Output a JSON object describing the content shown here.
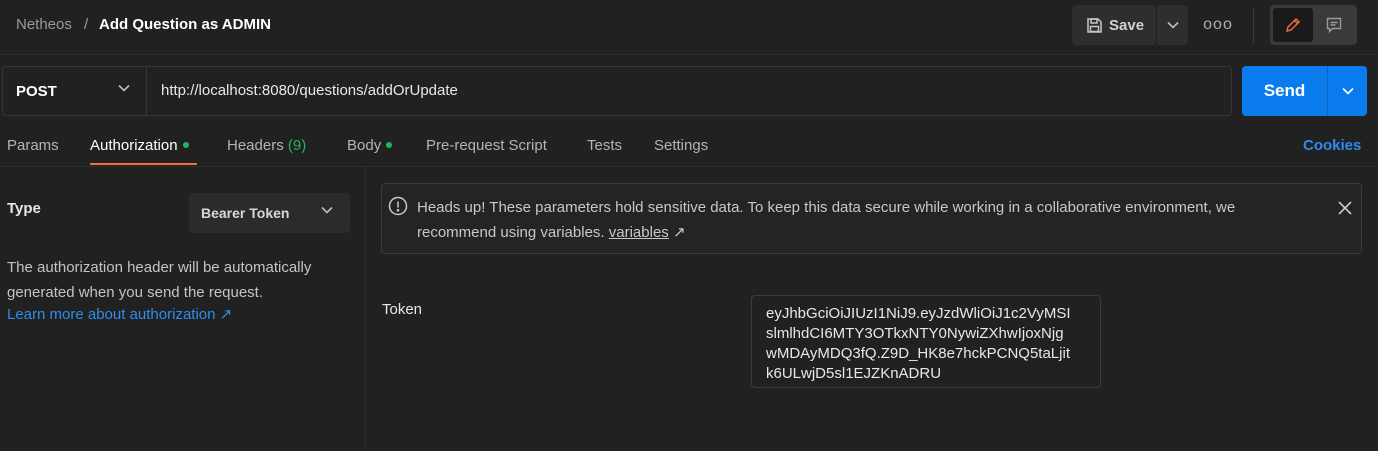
{
  "header": {
    "workspace": "Netheos",
    "separator": "/",
    "request_name": "Add Question as ADMIN",
    "save_label": "Save",
    "more_label": "ooo"
  },
  "request": {
    "method": "POST",
    "url": "http://localhost:8080/questions/addOrUpdate",
    "send_label": "Send"
  },
  "tabs": [
    {
      "label": "Params"
    },
    {
      "label": "Authorization",
      "dot": true,
      "active": true
    },
    {
      "label": "Headers",
      "count": "(9)"
    },
    {
      "label": "Body",
      "dot": true
    },
    {
      "label": "Pre-request Script"
    },
    {
      "label": "Tests"
    },
    {
      "label": "Settings"
    }
  ],
  "cookies_label": "Cookies",
  "auth": {
    "type_label": "Type",
    "type_value": "Bearer Token",
    "description": "The authorization header will be automatically generated when you send the request.",
    "learn_more": "Learn more about authorization ↗"
  },
  "alert": {
    "text": "Heads up! These parameters hold sensitive data. To keep this data secure while working in a collaborative environment, we recommend using variables.",
    "link": "variables",
    "link_arrow": "↗"
  },
  "token": {
    "label": "Token",
    "lines": [
      "eyJhbGciOiJIUzI1NiJ9.eyJzdWliOiJ1c2VyMSI",
      "slmlhdCI6MTY3OTkxNTY0NywiZXhwIjoxNjg",
      "wMDAyMDQ3fQ.Z9D_HK8e7hckPCNQ5taLjit",
      "k6ULwjD5sl1EJZKnADRU"
    ]
  },
  "colors": {
    "background": "#212121",
    "accent_send": "#097bed",
    "tab_active_underline": "#f26b3a",
    "status_dot": "#25b35a",
    "link": "#2e8bef"
  }
}
